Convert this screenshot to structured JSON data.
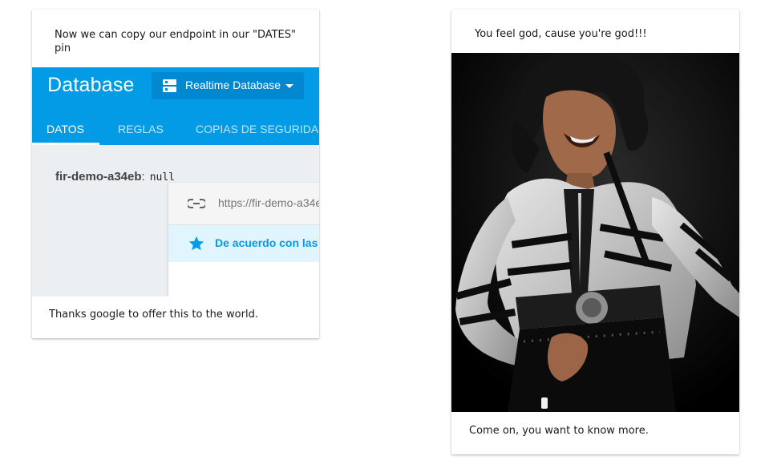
{
  "left_card": {
    "top_caption": "Now we can copy our endpoint in our \"DATES\" pin",
    "bottom_caption": "Thanks google to offer this to the world.",
    "screenshot": {
      "title": "Database",
      "db_selector_label": "Realtime Database",
      "tabs": [
        "DATOS",
        "REGLAS",
        "COPIAS DE SEGURIDAD"
      ],
      "active_tab": "DATOS",
      "url_text": "https://fir-demo-a34e",
      "info_text": "De acuerdo con las re",
      "node_key": "fir-demo-a34eb",
      "node_colon": ":",
      "node_value": "null",
      "colors": {
        "header": "#039be5",
        "selector": "#0288d1",
        "info_bg": "#e1f5fe",
        "accent": "#039be5"
      }
    }
  },
  "right_card": {
    "top_caption": "You feel god, cause you're god!!!",
    "bottom_caption": "Come on, you want to know more."
  }
}
